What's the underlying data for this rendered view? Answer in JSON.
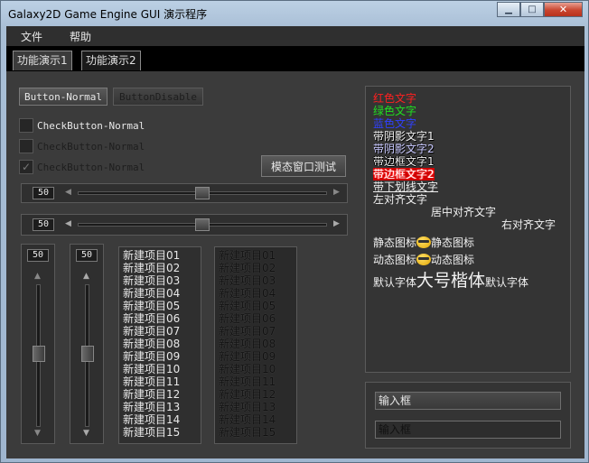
{
  "window": {
    "title": "Galaxy2D Game Engine GUI 演示程序"
  },
  "menu": {
    "items": [
      "文件",
      "帮助"
    ]
  },
  "tabs": [
    "功能演示1",
    "功能演示2"
  ],
  "buttons": {
    "normal": "Button-Normal",
    "disabled": "ButtonDisable",
    "modal": "模态窗口测试"
  },
  "checkbuttons": [
    {
      "label": "CheckButton-Normal",
      "checked": false,
      "enabled": true
    },
    {
      "label": "CheckButton-Normal",
      "checked": false,
      "enabled": false
    },
    {
      "label": "CheckButton-Normal",
      "checked": true,
      "enabled": false
    }
  ],
  "sliders": {
    "h1": {
      "value": "50",
      "level": 0.5
    },
    "h2": {
      "value": "50",
      "level": 0.5
    },
    "v1": {
      "value": "50",
      "level": 0.5
    },
    "v2": {
      "value": "50",
      "level": 0.5
    }
  },
  "list1": {
    "items": [
      "新建项目01",
      "新建项目02",
      "新建项目03",
      "新建项目04",
      "新建项目05",
      "新建项目06",
      "新建项目07",
      "新建项目08",
      "新建项目09",
      "新建项目10",
      "新建项目11",
      "新建项目12",
      "新建项目13",
      "新建项目14",
      "新建项目15"
    ]
  },
  "list2": {
    "items": [
      "新建项目01",
      "新建项目02",
      "新建项目03",
      "新建项目04",
      "新建项目05",
      "新建项目06",
      "新建项目07",
      "新建项目08",
      "新建项目09",
      "新建项目10",
      "新建项目11",
      "新建项目12",
      "新建项目13",
      "新建项目14",
      "新建项目15"
    ]
  },
  "textdemo": {
    "red": "红色文字",
    "green": "绿色文字",
    "blue": "蓝色文字",
    "shadow1": "带阴影文字1",
    "shadow2": "带阴影文字2",
    "border1": "带边框文字1",
    "border2": "带边框文字2",
    "underline": "带下划线文字",
    "left": "左对齐文字",
    "center": "居中对齐文字",
    "right": "右对齐文字",
    "static_pre": "静态图标",
    "static_post": "静态图标",
    "anim_pre": "动态图标",
    "anim_post": "动态图标",
    "font_default1": "默认字体",
    "font_big": "大号楷体",
    "font_default2": "默认字体"
  },
  "inputs": {
    "normal": "输入框",
    "disabled": "输入框"
  },
  "colors": {
    "red": "#ff2020",
    "green": "#20e020",
    "blue": "#3040ff",
    "bg": "#3b3b3b"
  }
}
